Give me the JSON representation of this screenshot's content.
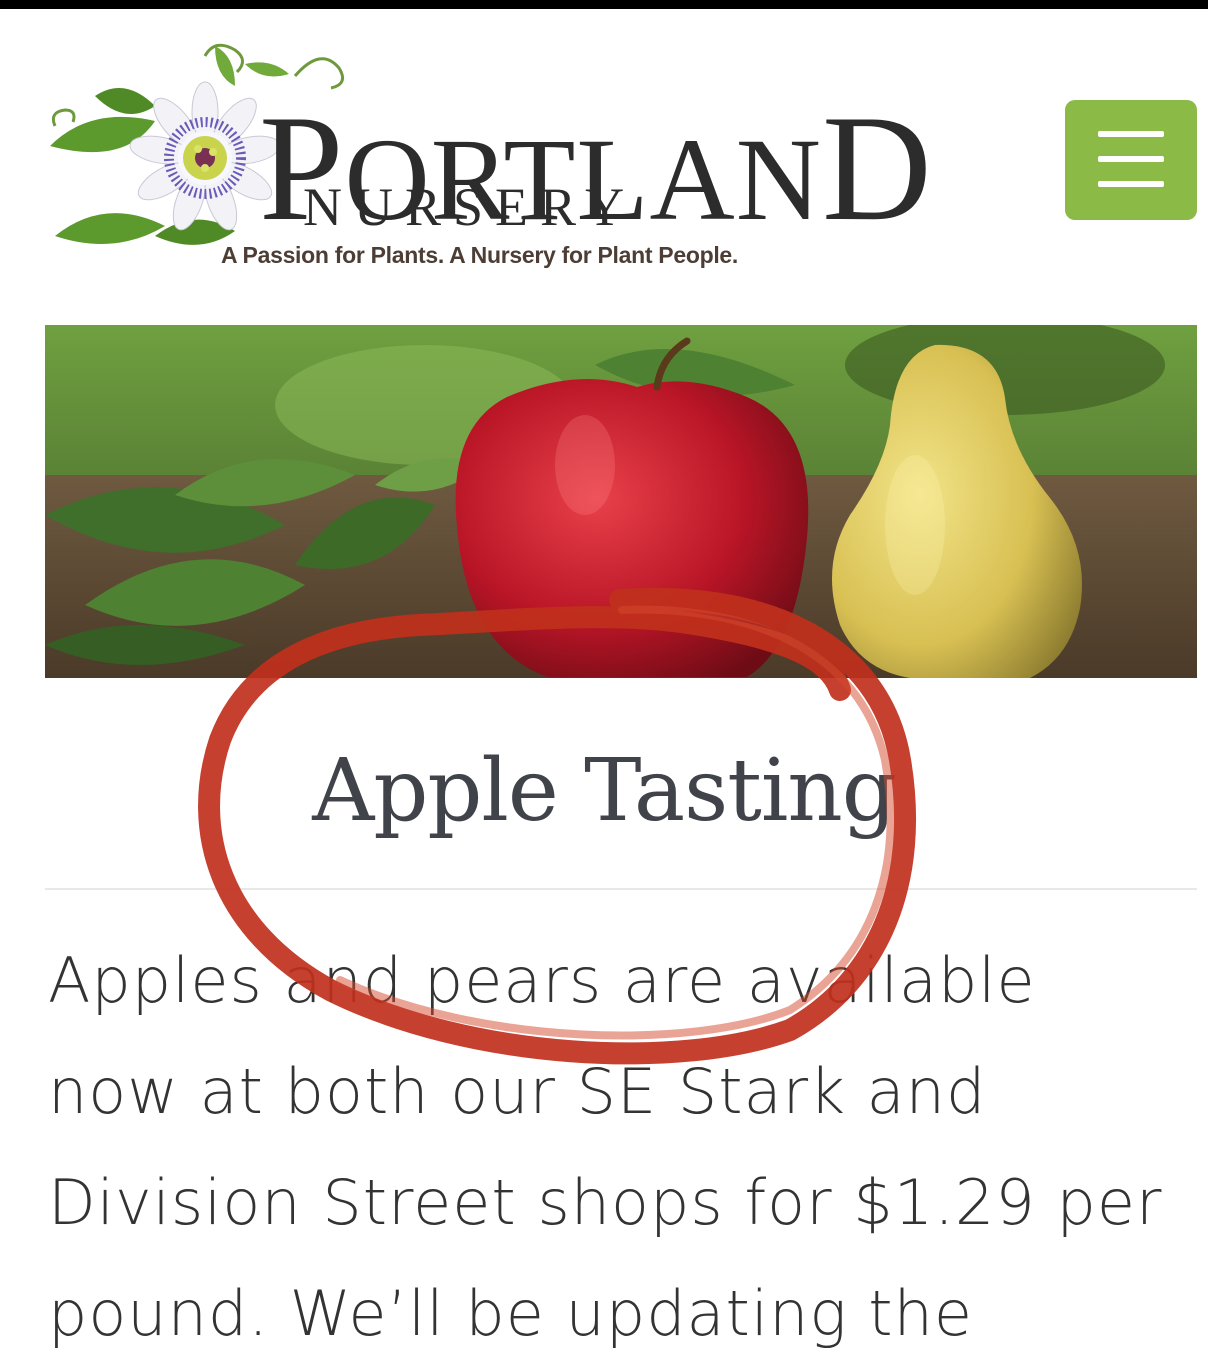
{
  "header": {
    "logo": {
      "name_initial": "P",
      "name_rest": "ORTLAN",
      "name_final": "D",
      "subname": "NURSERY",
      "tagline": "A Passion for Plants. A Nursery for Plant People."
    },
    "menu_icon": "hamburger-menu-icon",
    "menu_color": "#8cba46"
  },
  "hero": {
    "image": "red apple and yellow pear with leaves"
  },
  "article": {
    "title": "Apple Tasting",
    "body_lines": [
      "Apples and pears are available",
      "now at both our SE Stark and",
      "Division Street shops for $1.29 per",
      "pound. We’ll be updating the"
    ]
  },
  "annotation": {
    "shape": "hand-drawn circle",
    "color": "#c0301c"
  }
}
